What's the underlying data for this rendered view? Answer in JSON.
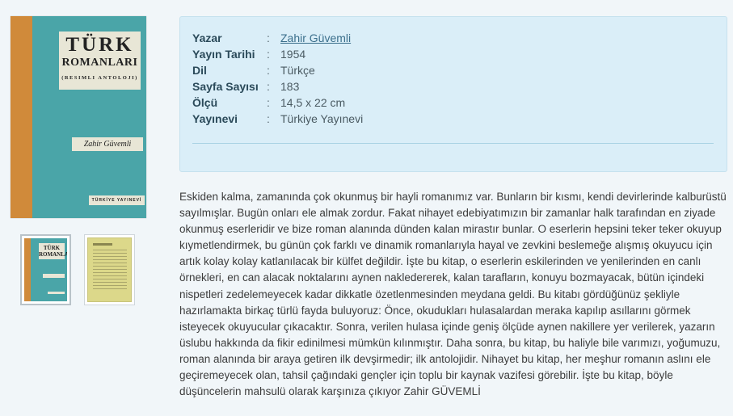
{
  "cover": {
    "title_line1": "TÜRK",
    "title_line2": "ROMANLARI",
    "subtitle": "(RESIMLI ANTOLOJI)",
    "author": "Zahir Güvemli",
    "publisher": "TÜRKİYE YAYINEVİ",
    "colors": {
      "background": "#4aa5a8",
      "spine": "#d08a3a",
      "label": "#e8e6d6"
    }
  },
  "thumbnails": [
    {
      "name": "front-cover",
      "mini_title": "TÜRK ROMANLARI"
    },
    {
      "name": "back-cover"
    }
  ],
  "details": [
    {
      "label": "Yazar",
      "sep": ":",
      "value": "Zahir Güvemli",
      "link": true
    },
    {
      "label": "Yayın Tarihi",
      "sep": ":",
      "value": "1954"
    },
    {
      "label": "Dil",
      "sep": ":",
      "value": "Türkçe"
    },
    {
      "label": "Sayfa Sayısı",
      "sep": ":",
      "value": "183"
    },
    {
      "label": "Ölçü",
      "sep": ":",
      "value": "14,5 x 22 cm"
    },
    {
      "label": "Yayınevi",
      "sep": ":",
      "value": "Türkiye Yayınevi"
    }
  ],
  "description": "Eskiden kalma, zamanında çok okunmuş bir hayli romanımız var. Bunların bir kısmı, kendi devirlerinde kalburüstü sayılmışlar. Bugün onları ele almak zordur. Fakat nihayet edebiyatımızın bir zamanlar halk tarafından en ziyade okunmuş eserleridir ve bize roman alanında dünden kalan mirastır bunlar. O eserlerin hepsini teker teker okuyup kıymetlendirmek, bu günün çok farklı ve dinamik romanlarıyla hayal ve zevkini beslemeğe alışmış okuyucu için artık kolay kolay katlanılacak bir külfet değildir. İşte bu kitap, o eserlerin eskilerinden ve yenilerinden en canlı örnekleri, en can alacak noktalarını aynen nakledererek, kalan tarafların, konuyu bozmayacak, bütün içindeki nispetleri zedelemeyecek kadar dikkatle özetlenmesinden meydana geldi. Bu kitabı gördüğünüz şekliyle hazırlamakta birkaç türlü fayda buluyoruz: Önce, okudukları hulasalardan meraka kapılıp asıllarını görmek isteyecek okuyucular çıkacaktır. Sonra, verilen hulasa içinde geniş ölçüde aynen nakillere yer verilerek, yazarın üslubu hakkında da fikir edinilmesi mümkün kılınmıştır. Daha sonra, bu kitap, bu haliyle bile varımızı, yoğumuzu, roman alanında bir araya getiren ilk devşirmedir; ilk antolojidir. Nihayet bu kitap, her meşhur romanın aslını ele geçiremeyecek olan, tahsil çağındaki gençler için toplu bir kaynak vazifesi görebilir. İşte bu kitap, böyle düşüncelerin mahsulü olarak karşınıza çıkıyor Zahir GÜVEMLİ"
}
